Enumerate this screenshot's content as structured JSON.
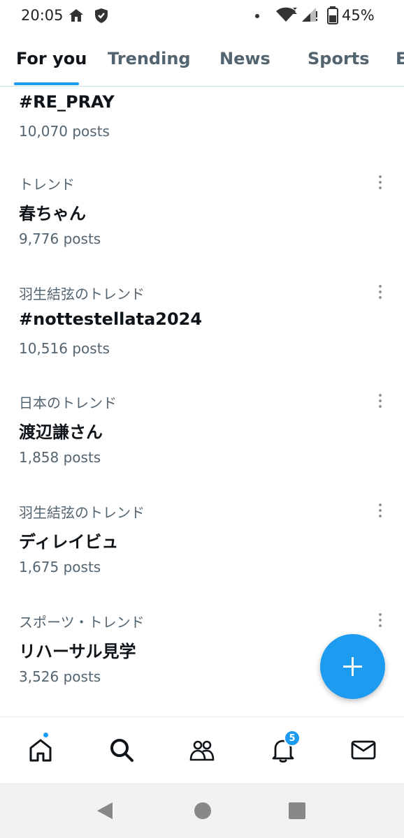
{
  "status_bar": {
    "time": "20:05",
    "battery": "45%"
  },
  "tabs": [
    {
      "label": "For you",
      "active": true
    },
    {
      "label": "Trending",
      "active": false
    },
    {
      "label": "News",
      "active": false
    },
    {
      "label": "Sports",
      "active": false
    },
    {
      "label": "E",
      "active": false
    }
  ],
  "trends": [
    {
      "context": "",
      "name": "#RE_PRAY",
      "count": "10,070 posts"
    },
    {
      "context": "トレンド",
      "name": "春ちゃん",
      "count": "9,776 posts"
    },
    {
      "context": "羽生結弦のトレンド",
      "name": "#nottestellata2024",
      "count": "10,516 posts"
    },
    {
      "context": "日本のトレンド",
      "name": "渡辺謙さん",
      "count": "1,858 posts"
    },
    {
      "context": "羽生結弦のトレンド",
      "name": "ディレイビュ",
      "count": "1,675 posts"
    },
    {
      "context": "スポーツ・トレンド",
      "name": "リハーサル見学",
      "count": "3,526 posts"
    }
  ],
  "bottom_nav": {
    "items": [
      "home-icon",
      "search-icon",
      "communities-icon",
      "notifications-icon",
      "messages-icon"
    ],
    "notification_count": "5"
  },
  "colors": {
    "accent": "#1d9bf0",
    "text_primary": "#0f1419",
    "text_secondary": "#536471"
  }
}
